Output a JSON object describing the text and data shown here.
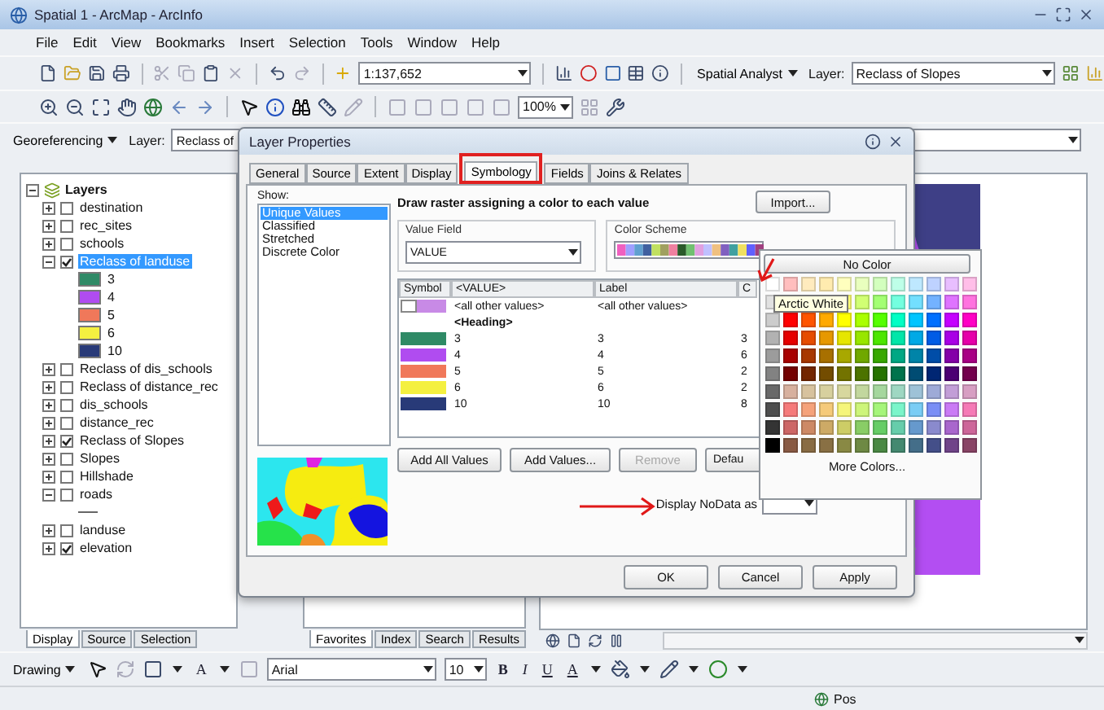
{
  "window": {
    "title": "Spatial 1 - ArcMap - ArcInfo"
  },
  "menu": [
    "File",
    "Edit",
    "View",
    "Bookmarks",
    "Insert",
    "Selection",
    "Tools",
    "Window",
    "Help"
  ],
  "standard_toolbar": {
    "scale": "1:137,652"
  },
  "spatial_analyst_toolbar": {
    "menu": "Spatial Analyst",
    "layer_label": "Layer:",
    "layer": "Reclass of Slopes"
  },
  "tools_toolbar": {
    "zoom_field": "100%"
  },
  "georeferencing_toolbar": {
    "menu": "Georeferencing",
    "layer_label": "Layer:",
    "layer": "Reclass of"
  },
  "toc": {
    "root": {
      "label": "Layers",
      "expanded": true,
      "children": [
        {
          "kind": "layer",
          "label": "destination",
          "checked": false,
          "expanded": false,
          "selected": false
        },
        {
          "kind": "layer",
          "label": "rec_sites",
          "checked": false,
          "expanded": false,
          "selected": false
        },
        {
          "kind": "layer",
          "label": "schools",
          "checked": false,
          "expanded": false,
          "selected": false
        },
        {
          "kind": "layer",
          "label": "Reclass of landuse",
          "checked": true,
          "expanded": true,
          "selected": true,
          "children": [
            {
              "kind": "swatch",
              "label": "3",
              "color": "#2f8a66"
            },
            {
              "kind": "swatch",
              "label": "4",
              "color": "#b04cf0"
            },
            {
              "kind": "swatch",
              "label": "5",
              "color": "#f0785a"
            },
            {
              "kind": "swatch",
              "label": "6",
              "color": "#f4f040"
            },
            {
              "kind": "swatch",
              "label": "10",
              "color": "#283a78"
            }
          ]
        },
        {
          "kind": "layer",
          "label": "Reclass of dis_schools",
          "checked": false,
          "expanded": false,
          "selected": false
        },
        {
          "kind": "layer",
          "label": "Reclass of distance_rec",
          "checked": false,
          "expanded": false,
          "selected": false
        },
        {
          "kind": "layer",
          "label": "dis_schools",
          "checked": false,
          "expanded": false,
          "selected": false
        },
        {
          "kind": "layer",
          "label": "distance_rec",
          "checked": false,
          "expanded": false,
          "selected": false
        },
        {
          "kind": "layer",
          "label": "Reclass of Slopes",
          "checked": true,
          "expanded": false,
          "selected": false
        },
        {
          "kind": "layer",
          "label": "Slopes",
          "checked": false,
          "expanded": false,
          "selected": false
        },
        {
          "kind": "layer",
          "label": "Hillshade",
          "checked": false,
          "expanded": false,
          "selected": false
        },
        {
          "kind": "layer",
          "label": "roads",
          "checked": false,
          "expanded": true,
          "selected": false,
          "children": [
            {
              "kind": "line"
            }
          ]
        },
        {
          "kind": "layer",
          "label": "landuse",
          "checked": false,
          "expanded": false,
          "selected": false
        },
        {
          "kind": "layer",
          "label": "elevation",
          "checked": true,
          "expanded": false,
          "selected": false
        }
      ]
    },
    "tabs": [
      {
        "label": "Display",
        "selected": true
      },
      {
        "label": "Source",
        "selected": false
      },
      {
        "label": "Selection",
        "selected": false
      }
    ]
  },
  "catalog": {
    "tabs": [
      {
        "label": "Favorites",
        "selected": true
      },
      {
        "label": "Index",
        "selected": false
      },
      {
        "label": "Search",
        "selected": false
      },
      {
        "label": "Results",
        "selected": false
      }
    ]
  },
  "layer_properties": {
    "title": "Layer Properties",
    "tabs": [
      {
        "label": "General",
        "selected": false,
        "highlighted": false
      },
      {
        "label": "Source",
        "selected": false,
        "highlighted": false
      },
      {
        "label": "Extent",
        "selected": false,
        "highlighted": false
      },
      {
        "label": "Display",
        "selected": false,
        "highlighted": false
      },
      {
        "label": "Symbology",
        "selected": true,
        "highlighted": true
      },
      {
        "label": "Fields",
        "selected": false,
        "highlighted": false
      },
      {
        "label": "Joins & Relates",
        "selected": false,
        "highlighted": false
      }
    ],
    "show_label": "Show:",
    "show_options": [
      {
        "label": "Unique Values",
        "selected": true
      },
      {
        "label": "Classified",
        "selected": false
      },
      {
        "label": "Stretched",
        "selected": false
      },
      {
        "label": "Discrete Color",
        "selected": false
      }
    ],
    "heading": "Draw raster assigning a color to each value",
    "import_button": "Import...",
    "value_field": {
      "label": "Value Field",
      "value": "VALUE"
    },
    "color_scheme": {
      "label": "Color Scheme"
    },
    "table": {
      "columns": [
        "Symbol",
        "<VALUE>",
        "Label",
        "C"
      ],
      "rows": [
        {
          "kind": "other",
          "color": "#c88ae6",
          "value": "<all other values>",
          "label": "<all other values>"
        },
        {
          "kind": "heading",
          "value": "<Heading>"
        },
        {
          "kind": "value",
          "color": "#2f8a66",
          "value": "3",
          "label": "3",
          "column_4": "3"
        },
        {
          "kind": "value",
          "color": "#b04cf0",
          "value": "4",
          "label": "4",
          "column_4": "6"
        },
        {
          "kind": "value",
          "color": "#f0785a",
          "value": "5",
          "label": "5",
          "column_4": "2"
        },
        {
          "kind": "value",
          "color": "#f4f040",
          "value": "6",
          "label": "6",
          "column_4": "2"
        },
        {
          "kind": "value",
          "color": "#283a78",
          "value": "10",
          "label": "10",
          "column_4": "8"
        }
      ]
    },
    "buttons": [
      {
        "label": "Add All Values",
        "disabled": false
      },
      {
        "label": "Add Values...",
        "disabled": false
      },
      {
        "label": "Remove",
        "disabled": true
      },
      {
        "label": "Defau",
        "disabled": false
      }
    ],
    "nodata_label": "Display NoData as",
    "footer_buttons": [
      "OK",
      "Cancel",
      "Apply"
    ]
  },
  "color_picker": {
    "no_color": "No Color",
    "tooltip": "Arctic White",
    "more_colors": "More Colors...",
    "rows": [
      [
        {
          "color": "#ffffff"
        },
        {
          "color": "#ffbebe"
        },
        {
          "color": "#ffebbe"
        },
        {
          "color": "#ffebaf"
        },
        {
          "color": "#ffffbe"
        },
        {
          "color": "#e9ffbe"
        },
        {
          "color": "#d3ffbe"
        },
        {
          "color": "#beffe8"
        },
        {
          "color": "#bee8ff"
        },
        {
          "color": "#bed2ff"
        },
        {
          "color": "#e8beff"
        },
        {
          "color": "#ffbee8"
        }
      ],
      [
        {
          "color": "#e1e1e1"
        },
        null,
        null,
        null,
        {
          "color": "#ffff73"
        },
        {
          "color": "#d1ff73"
        },
        {
          "color": "#a3ff73"
        },
        {
          "color": "#73ffdf"
        },
        {
          "color": "#73dfff"
        },
        {
          "color": "#73b2ff"
        },
        {
          "color": "#df73ff"
        },
        {
          "color": "#ff73df"
        }
      ],
      [
        {
          "color": "#cccccc"
        },
        {
          "color": "#ff0000"
        },
        {
          "color": "#ff5500"
        },
        {
          "color": "#ffaa00"
        },
        {
          "color": "#ffff00"
        },
        {
          "color": "#aaff00"
        },
        {
          "color": "#55ff00"
        },
        {
          "color": "#00ffc5"
        },
        {
          "color": "#00c5ff"
        },
        {
          "color": "#0070ff"
        },
        {
          "color": "#c500ff"
        },
        {
          "color": "#ff00c5"
        }
      ],
      [
        {
          "color": "#b2b2b2"
        },
        {
          "color": "#e60000"
        },
        {
          "color": "#e64c00"
        },
        {
          "color": "#e69800"
        },
        {
          "color": "#e6e600"
        },
        {
          "color": "#98e600"
        },
        {
          "color": "#4ce600"
        },
        {
          "color": "#00e6a9"
        },
        {
          "color": "#00a9e6"
        },
        {
          "color": "#005ce6"
        },
        {
          "color": "#a900e6"
        },
        {
          "color": "#e600a9"
        }
      ],
      [
        {
          "color": "#9c9c9c"
        },
        {
          "color": "#a80000"
        },
        {
          "color": "#a83800"
        },
        {
          "color": "#a87000"
        },
        {
          "color": "#a8a800"
        },
        {
          "color": "#70a800"
        },
        {
          "color": "#38a800"
        },
        {
          "color": "#00a884"
        },
        {
          "color": "#0084a8"
        },
        {
          "color": "#004da8"
        },
        {
          "color": "#8400a8"
        },
        {
          "color": "#a80084"
        }
      ],
      [
        {
          "color": "#828282"
        },
        {
          "color": "#730000"
        },
        {
          "color": "#732600"
        },
        {
          "color": "#734c00"
        },
        {
          "color": "#737300"
        },
        {
          "color": "#4c7300"
        },
        {
          "color": "#267300"
        },
        {
          "color": "#00734c"
        },
        {
          "color": "#004c73"
        },
        {
          "color": "#002673"
        },
        {
          "color": "#4c0073"
        },
        {
          "color": "#73004c"
        }
      ],
      [
        {
          "color": "#686868"
        },
        {
          "color": "#d7b09e"
        },
        {
          "color": "#d7c29e"
        },
        {
          "color": "#d7d09e"
        },
        {
          "color": "#d7d79e"
        },
        {
          "color": "#c2d79e"
        },
        {
          "color": "#a5d79e"
        },
        {
          "color": "#9ed7c2"
        },
        {
          "color": "#9ec2d7"
        },
        {
          "color": "#9eaad7"
        },
        {
          "color": "#c29ed7"
        },
        {
          "color": "#d79ec2"
        }
      ],
      [
        {
          "color": "#4e4e4e"
        },
        {
          "color": "#f57a7a"
        },
        {
          "color": "#f5a27a"
        },
        {
          "color": "#f5ca7a"
        },
        {
          "color": "#f5f57a"
        },
        {
          "color": "#cdf57a"
        },
        {
          "color": "#a5f57a"
        },
        {
          "color": "#7af5ca"
        },
        {
          "color": "#7acdf5"
        },
        {
          "color": "#7a8ef5"
        },
        {
          "color": "#ca7af5"
        },
        {
          "color": "#f57ab6"
        }
      ],
      [
        {
          "color": "#343434"
        },
        {
          "color": "#cd6666"
        },
        {
          "color": "#cd8966"
        },
        {
          "color": "#cdaa66"
        },
        {
          "color": "#cdcd66"
        },
        {
          "color": "#89cd66"
        },
        {
          "color": "#66cd66"
        },
        {
          "color": "#66cdab"
        },
        {
          "color": "#6699cd"
        },
        {
          "color": "#8a8acd"
        },
        {
          "color": "#a966cd"
        },
        {
          "color": "#cd6699"
        }
      ],
      [
        {
          "color": "#000000"
        },
        {
          "color": "#895a44"
        },
        {
          "color": "#896c44"
        },
        {
          "color": "#897044"
        },
        {
          "color": "#898944"
        },
        {
          "color": "#6e8944"
        },
        {
          "color": "#4a8944"
        },
        {
          "color": "#448970"
        },
        {
          "color": "#446e89"
        },
        {
          "color": "#444f89"
        },
        {
          "color": "#704489"
        },
        {
          "color": "#894465"
        }
      ]
    ]
  },
  "drawing_toolbar": {
    "menu": "Drawing",
    "text_tool": "A",
    "font": "Arial",
    "size": "10",
    "bold": "B",
    "italic": "I",
    "underline": "U",
    "font_color": "A"
  },
  "status_bar": {
    "position": "Pos"
  }
}
